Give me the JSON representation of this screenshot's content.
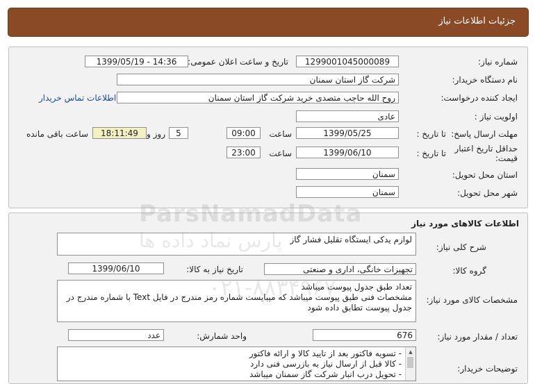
{
  "header": {
    "title": "جزئیات اطلاعات نیاز"
  },
  "details": {
    "need_number_label": "شماره نیاز:",
    "need_number": "1299001045000089",
    "announce_label": "تاریخ و ساعت اعلان عمومی:",
    "announce_value": "1399/05/19 - 14:36",
    "buyer_label": "نام دستگاه خریدار:",
    "buyer_value": "شرکت گاز استان سمنان",
    "creator_label": "ایجاد کننده درخواست:",
    "creator_value": "روح الله  حاجب متصدی خرید شرکت گاز استان سمنان",
    "contact_link": "اطلاعات تماس خریدار",
    "priority_label": "اولویت نیاز :",
    "priority_value": "عادی",
    "deadline_label": "مهلت ارسال پاسخ:",
    "until_date_label": "تا تاریخ :",
    "deadline_date": "1399/05/25",
    "time_label": "ساعت",
    "deadline_time": "09:00",
    "days_value": "5",
    "days_label": "روز و",
    "remaining_time": "18:11:49",
    "remaining_label": "ساعت باقی مانده",
    "validity_label": "حداقل تاریخ اعتبار قیمت:",
    "validity_until_label": "تا تاریخ :",
    "validity_date": "1399/06/10",
    "validity_time_label": "ساعت",
    "validity_time": "23:00",
    "province_label": "استان محل تحویل:",
    "province_value": "سمنان",
    "city_label": "شهر محل تحویل:",
    "city_value": "سمنان"
  },
  "goods": {
    "title": "اطلاعات کالاهای مورد نیاز",
    "summary_label": "شرح کلی نیاز:",
    "summary_value": "لوازم یدکی ایستگاه تقلیل فشار گاز",
    "group_label": "گروه کالا:",
    "group_value": "تجهیزات خانگی، اداری و صنعتی",
    "need_date_label": "تاریخ نیاز به کالا:",
    "need_date": "1399/06/10",
    "spec_label": "مشخصات کالای مورد نیاز:",
    "spec_lines": [
      "تعداد طبق جدول پیوست میباشد",
      "مشخصات فنی طبق پیوست میباشد که میبایست شماره رمز مندرج در فایل Text با شماره مندرج در جدول پیوست تطابق داده شود"
    ],
    "qty_label": "تعداد / مقدار مورد نیاز:",
    "qty_value": "676",
    "unit_label": "واحد شمارش:",
    "unit_value": "عدد",
    "buyer_notes_label": "توضیحات خریدار:",
    "buyer_notes": [
      "- تسویه فاکتور بعد از تایید کالا و ارائه فاکتور",
      "- کالا قبل از ارسال نیاز به بازرسی فنی دارد",
      "- تحویل درب انبار شرکت گاز سمنان میباشد"
    ]
  },
  "watermark": {
    "brand": "ParsNamadData",
    "fa": "پارس نماد داده ها",
    "phone": "۰۲۱-۸۸۳۴۹۶۷"
  }
}
